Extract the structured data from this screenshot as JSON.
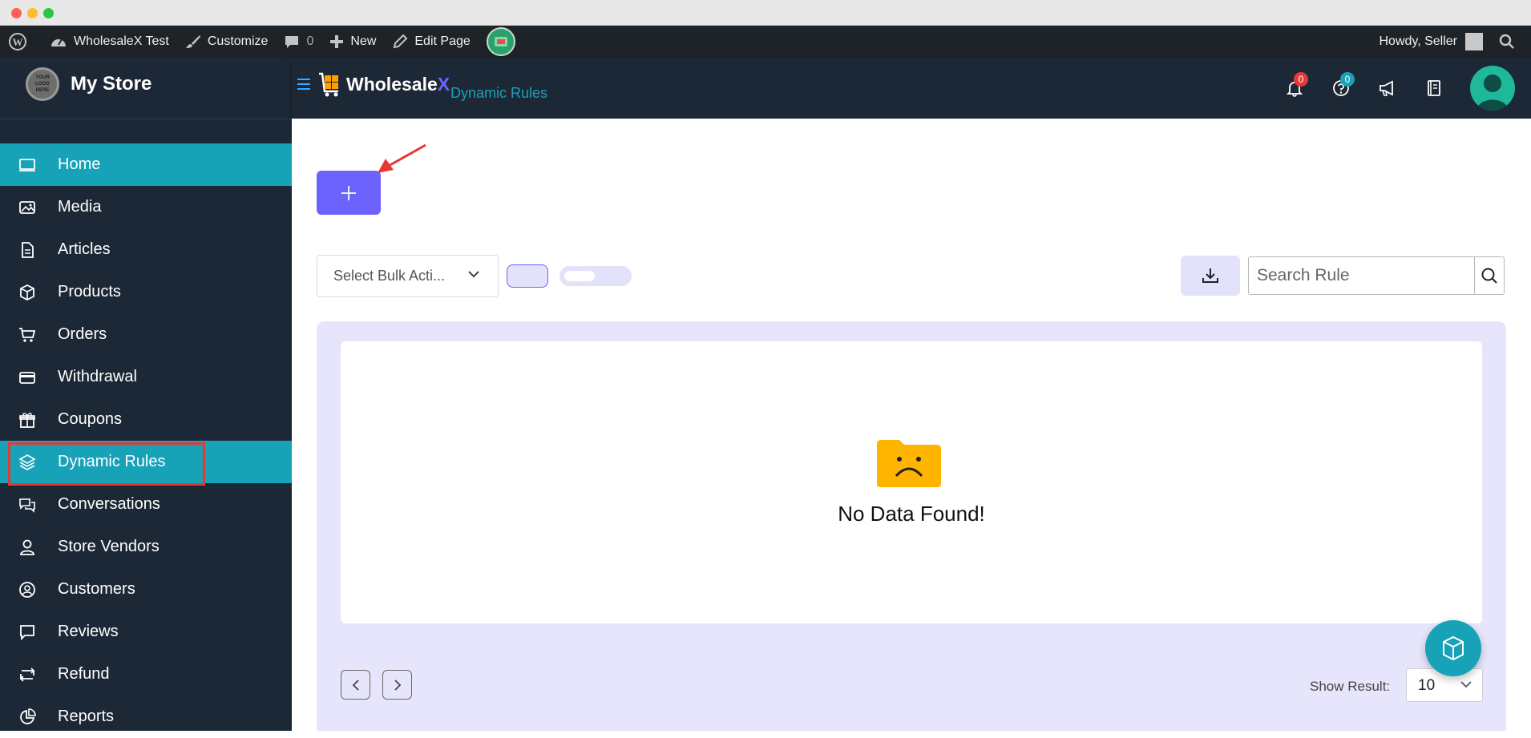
{
  "admin_bar": {
    "site_name": "WholesaleX Test",
    "customize": "Customize",
    "comments_count": "0",
    "new_label": "New",
    "edit_page": "Edit Page",
    "howdy": "Howdy, Seller"
  },
  "sidebar": {
    "logo_text": "YOUR LOGO HERE",
    "store_name": "My Store",
    "items": [
      {
        "label": "Home",
        "icon": "laptop-icon"
      },
      {
        "label": "Media",
        "icon": "image-icon"
      },
      {
        "label": "Articles",
        "icon": "document-icon"
      },
      {
        "label": "Products",
        "icon": "box-icon"
      },
      {
        "label": "Orders",
        "icon": "cart-icon"
      },
      {
        "label": "Withdrawal",
        "icon": "credit-card-icon"
      },
      {
        "label": "Coupons",
        "icon": "gift-icon"
      },
      {
        "label": "Dynamic Rules",
        "icon": "layers-icon"
      },
      {
        "label": "Conversations",
        "icon": "chat-icon"
      },
      {
        "label": "Store Vendors",
        "icon": "user-icon"
      },
      {
        "label": "Customers",
        "icon": "user-circle-icon"
      },
      {
        "label": "Reviews",
        "icon": "comment-icon"
      },
      {
        "label": "Refund",
        "icon": "refund-icon"
      },
      {
        "label": "Reports",
        "icon": "pie-chart-icon"
      }
    ]
  },
  "header": {
    "brand_main": "Wholesale",
    "brand_x": "X",
    "page_title": "Dynamic Rules",
    "notifications_count": "0",
    "help_count": "0"
  },
  "toolbar": {
    "add_label": "+",
    "bulk_action_placeholder": "Select Bulk Acti...",
    "search_placeholder": "Search Rule"
  },
  "table": {
    "empty_message": "No Data Found!"
  },
  "pagination": {
    "show_result_label": "Show Result:",
    "show_result_value": "10"
  },
  "colors": {
    "sidebar_bg": "#1d2836",
    "accent_teal": "#17a2b8",
    "primary_purple": "#6c63ff",
    "empty_folder": "#ffb400"
  }
}
